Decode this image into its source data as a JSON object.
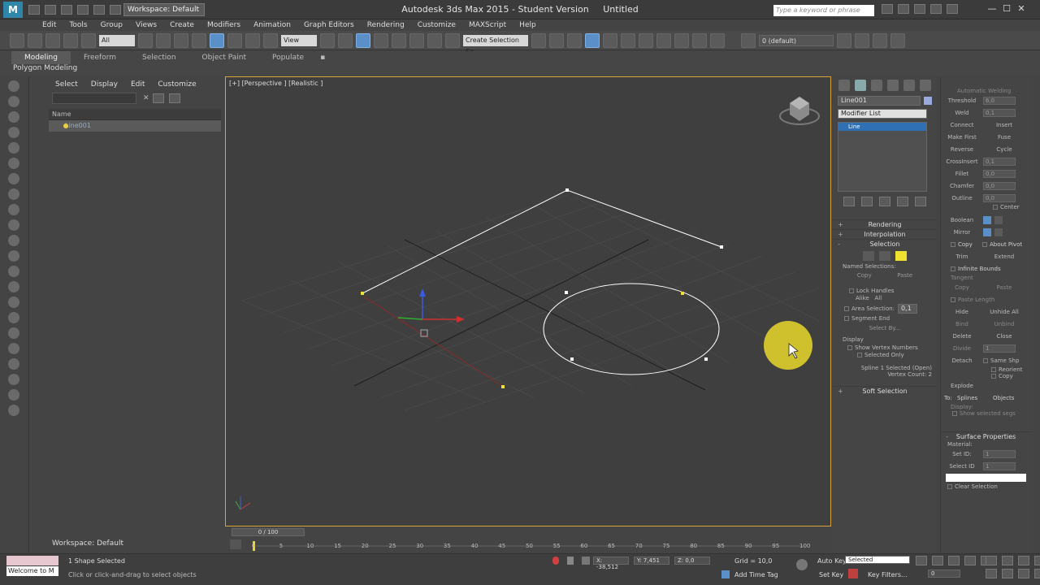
{
  "titlebar": {
    "workspace": "Workspace: Default",
    "app_title": "Autodesk 3ds Max  2015   - Student Version",
    "doc_name": "Untitled",
    "search_placeholder": "Type a keyword or phrase",
    "minimize": "—",
    "maximize": "☐",
    "close": "✕"
  },
  "menu": [
    "Edit",
    "Tools",
    "Group",
    "Views",
    "Create",
    "Modifiers",
    "Animation",
    "Graph Editors",
    "Rendering",
    "Customize",
    "MAXScript",
    "Help"
  ],
  "toolbar": {
    "filter": "All",
    "reference": "View",
    "selection_set": "Create Selection Se",
    "layer": "0 (default)"
  },
  "ribbon": {
    "tabs": [
      "Modeling",
      "Freeform",
      "Selection",
      "Object Paint",
      "Populate"
    ],
    "active_tab": "Modeling",
    "sub_label": "Polygon Modeling"
  },
  "explorer": {
    "menu": [
      "Select",
      "Display",
      "Edit",
      "Customize"
    ],
    "column_header": "Name",
    "items": [
      "Line001"
    ],
    "workspace_label": "Workspace: Default"
  },
  "viewport": {
    "label": "[+] [Perspective ] [Realistic ]"
  },
  "timeline": {
    "slider_text": "0 / 100",
    "ticks": [
      "0",
      "5",
      "10",
      "15",
      "20",
      "25",
      "30",
      "35",
      "40",
      "45",
      "50",
      "55",
      "60",
      "65",
      "70",
      "75",
      "80",
      "85",
      "90",
      "95",
      "100"
    ]
  },
  "command_panel": {
    "object_name": "Line001",
    "modifier_list": "Modifier List",
    "stack_item": "Line",
    "rollouts": {
      "rendering": "Rendering",
      "interpolation": "Interpolation",
      "selection": "Selection",
      "soft_selection": "Soft Selection"
    },
    "named_selections": "Named Selections:",
    "copy": "Copy",
    "paste": "Paste",
    "lock_handles": "Lock Handles",
    "alike": "Alike",
    "all": "All",
    "area_selection": "Area Selection:",
    "area_value": "0,1",
    "segment_end": "Segment End",
    "select_by": "Select By...",
    "display": "Display",
    "show_vertex_numbers": "Show Vertex Numbers",
    "selected_only": "Selected Only",
    "status_line1": "Spline 1 Selected (Open)",
    "status_line2": "Vertex Count: 2"
  },
  "panel2": {
    "automatic_welding": "Automatic Welding",
    "threshold": "Threshold",
    "threshold_val": "6,0",
    "weld": "Weld",
    "weld_val": "0,1",
    "connect": "Connect",
    "insert": "Insert",
    "make_first": "Make First",
    "fuse": "Fuse",
    "reverse": "Reverse",
    "cycle": "Cycle",
    "crossinsert": "CrossInsert",
    "crossinsert_val": "0,1",
    "fillet": "Fillet",
    "fillet_val": "0,0",
    "chamfer": "Chamfer",
    "chamfer_val": "0,0",
    "outline": "Outline",
    "outline_val": "0,0",
    "center": "Center",
    "boolean": "Boolean",
    "mirror": "Mirror",
    "copy": "Copy",
    "about_pivot": "About Pivot",
    "trim": "Trim",
    "extend": "Extend",
    "infinite_bounds": "Infinite Bounds",
    "tangent": "Tangent",
    "t_copy": "Copy",
    "t_paste": "Paste",
    "paste_length": "Paste Length",
    "hide": "Hide",
    "unhide_all": "Unhide All",
    "bind": "Bind",
    "unbind": "Unbind",
    "delete": "Delete",
    "close": "Close",
    "divide": "Divide",
    "divide_val": "1",
    "detach": "Detach",
    "same_shp": "Same Shp",
    "reorient": "Reorient",
    "d_copy": "Copy",
    "explode": "Explode",
    "to": "To:",
    "splines": "Splines",
    "objects": "Objects",
    "display": "Display:",
    "show_selected_segs": "Show selected segs",
    "surface_properties": "Surface Properties",
    "material": "Material:",
    "set_id": "Set ID:",
    "set_id_val": "1",
    "select_id": "Select ID",
    "select_id_val": "1",
    "clear_selection": "Clear Selection"
  },
  "status": {
    "selection": "1 Shape Selected",
    "prompt": "Click or click-and-drag to select objects",
    "welcome": "Welcome to M",
    "x": "X: -38,512",
    "y": "Y: 7,451",
    "z": "Z: 0,0",
    "grid": "Grid = 10,0",
    "add_time_tag": "Add Time Tag",
    "auto_key": "Auto Key",
    "selected": "Selected",
    "set_key": "Set Key",
    "key_filters": "Key Filters...",
    "frame": "0"
  },
  "colors": {
    "viewport_border": "#d7a33a",
    "selection_blue": "#2f6fb4",
    "cursor_highlight": "#e8d82a"
  }
}
